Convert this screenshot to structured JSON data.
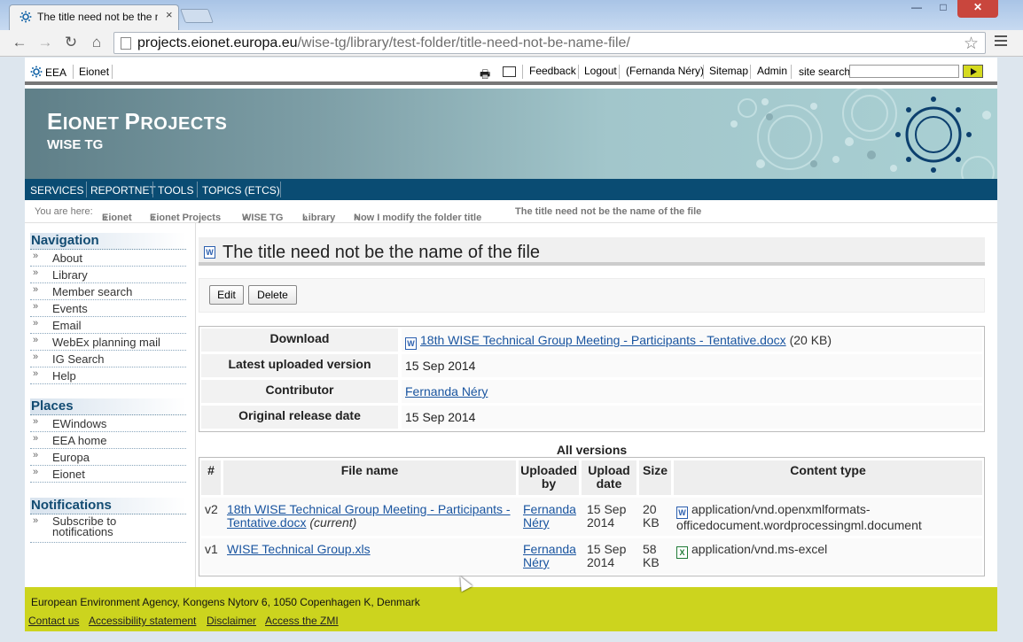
{
  "browser": {
    "tab_title": "The title need not be the name of the file",
    "tab_close": "×",
    "url_host": "projects.eionet.europa.eu",
    "url_path": "/wise-tg/library/test-folder/title-need-not-be-name-file/"
  },
  "topbar": {
    "eea": "EEA",
    "eionet": "Eionet",
    "feedback": "Feedback",
    "logout": "Logout",
    "user": "(Fernanda Néry)",
    "sitemap": "Sitemap",
    "admin": "Admin",
    "search_label": "site search",
    "search_value": ""
  },
  "banner": {
    "title_first_big": "E",
    "title_rest_1": "IONET ",
    "title_p": "P",
    "title_rest_2": "ROJECTS",
    "subtitle": "WISE TG"
  },
  "mainnav": [
    "SERVICES",
    "REPORTNET",
    "TOOLS",
    "TOPICS (ETCS)"
  ],
  "breadcrumb": {
    "label": "You are here:",
    "items": [
      "Eionet",
      "Eionet Projects",
      "WISE TG",
      "Library",
      "Now I modify the folder title",
      "The title need not be the name of the file"
    ],
    "sep": "»"
  },
  "sidebar": {
    "navigation_title": "Navigation",
    "navigation": [
      "About",
      "Library",
      "Member search",
      "Events",
      "Email",
      "WebEx planning mail",
      "IG Search",
      "Help"
    ],
    "places_title": "Places",
    "places": [
      "EWindows",
      "EEA home",
      "Europa",
      "Eionet"
    ],
    "notifications_title": "Notifications",
    "notifications": [
      "Subscribe to notifications"
    ],
    "bullet": "»"
  },
  "content": {
    "title": "The title need not be the name of the file",
    "edit": "Edit",
    "delete": "Delete",
    "details": {
      "download_label": "Download",
      "download_file": "18th WISE Technical Group Meeting - Participants - Tentative.docx",
      "download_size": "(20 KB)",
      "latest_label": "Latest uploaded version",
      "latest_value": "15 Sep 2014",
      "contributor_label": "Contributor",
      "contributor_value": "Fernanda Néry",
      "release_label": "Original release date",
      "release_value": "15 Sep 2014"
    },
    "versions_caption": "All versions",
    "versions_headers": {
      "num": "#",
      "file": "File name",
      "by": "Uploaded by",
      "date": "Upload date",
      "size": "Size",
      "type": "Content type"
    },
    "versions": [
      {
        "num": "v2",
        "file": "18th WISE Technical Group Meeting - Participants - Tentative.docx",
        "current": "(current)",
        "by": "Fernanda Néry",
        "date": "15 Sep 2014",
        "size": "20 KB",
        "type": "application/vnd.openxmlformats-officedocument.wordprocessingml.document"
      },
      {
        "num": "v1",
        "file": "WISE Technical Group.xls",
        "current": "",
        "by": "Fernanda Néry",
        "date": "15 Sep 2014",
        "size": "58 KB",
        "type": "application/vnd.ms-excel"
      }
    ]
  },
  "footer": {
    "address": "European Environment Agency, Kongens Nytorv 6, 1050 Copenhagen K, Denmark",
    "links": [
      "Contact us",
      "Accessibility statement",
      "Disclaimer",
      "Access the ZMI"
    ]
  },
  "colors": {
    "nav_bar": "#0a4c73",
    "footer": "#ccd41e",
    "link": "#1a55a0",
    "search_go": "#d5da1f"
  }
}
